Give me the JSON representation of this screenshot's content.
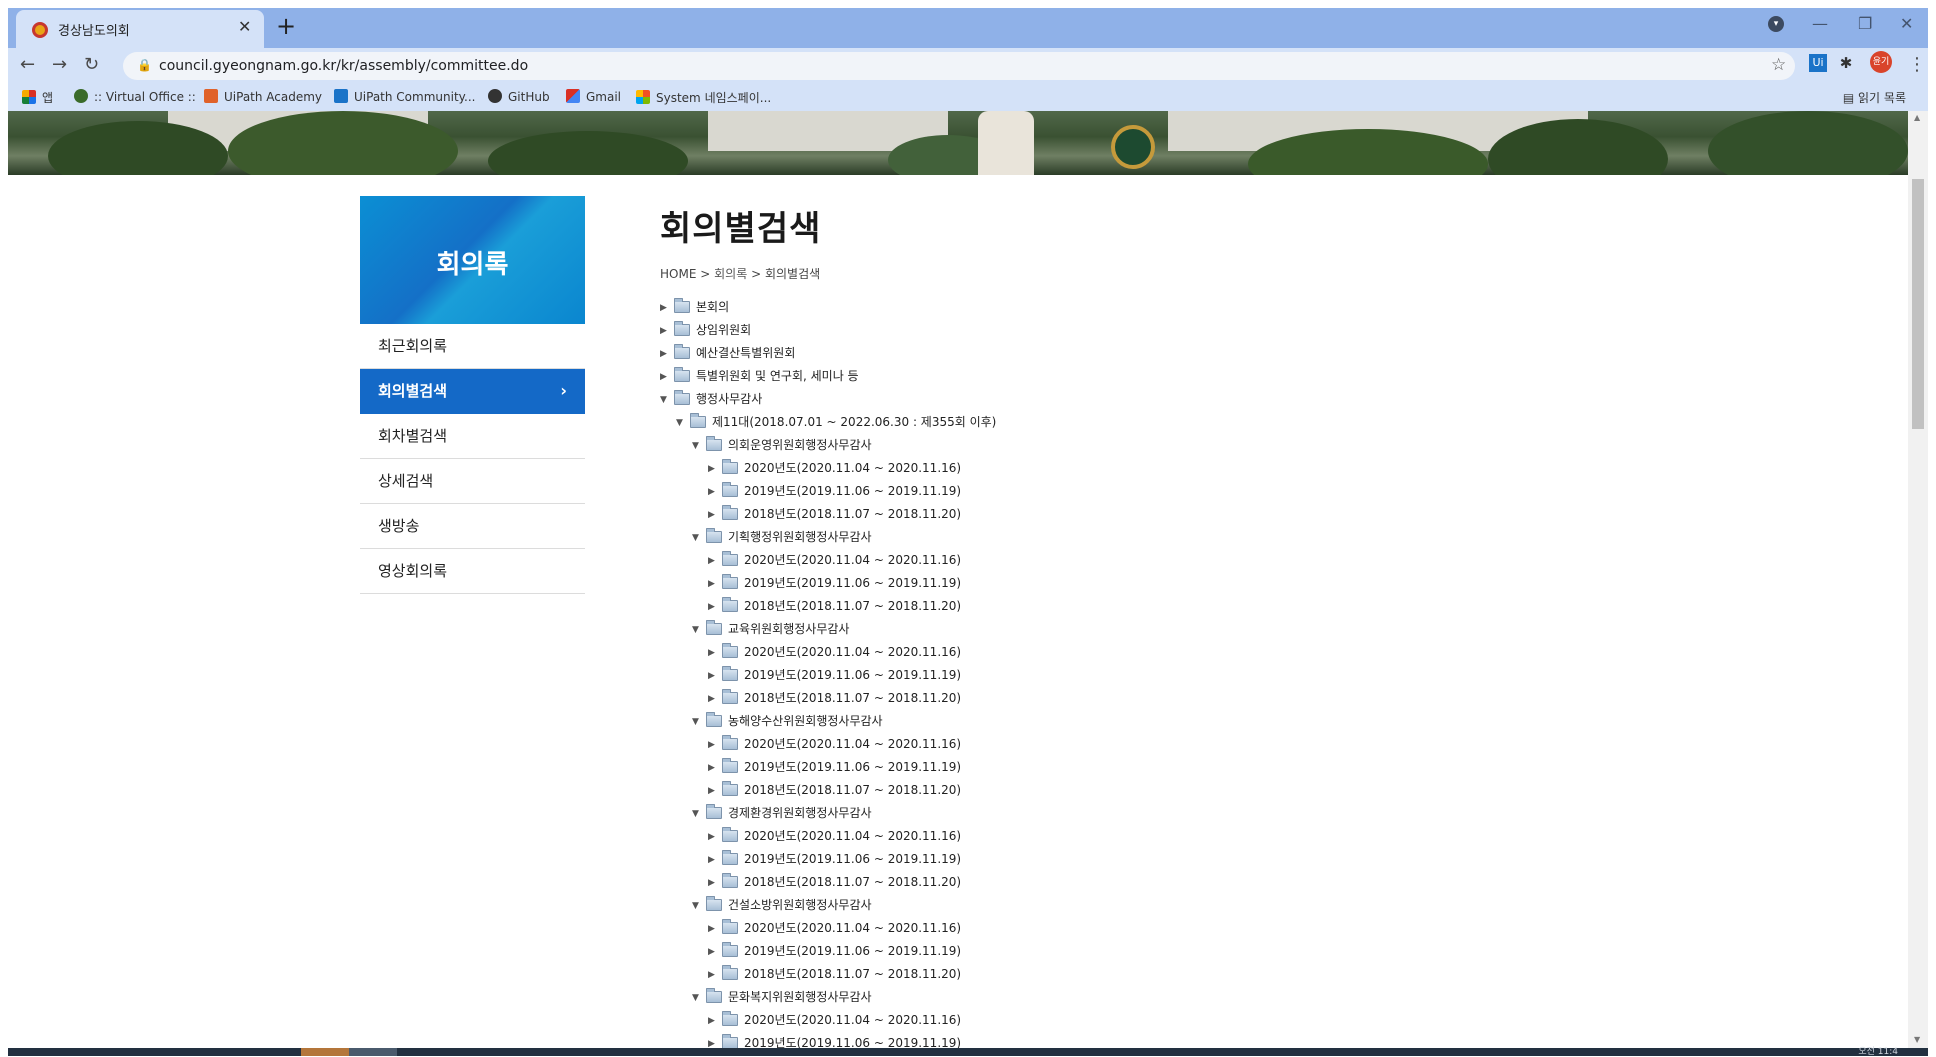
{
  "browser": {
    "tab_title": "경상남도의회",
    "tab_close": "✕",
    "new_tab": "+",
    "url": "council.gyeongnam.go.kr/kr/assembly/committee.do",
    "user_label": "윤기",
    "bookmarks": [
      {
        "label": "앱",
        "icon": "apps-grid-icon",
        "color": "#d93025"
      },
      {
        "label": ":: Virtual Office ::",
        "icon": "virtual-office-icon",
        "color": "#3a6b2a"
      },
      {
        "label": "UiPath Academy",
        "icon": "uipath-icon",
        "color": "#e0622a"
      },
      {
        "label": "UiPath Community...",
        "icon": "uipath-icon",
        "color": "#1a73c8"
      },
      {
        "label": "GitHub",
        "icon": "github-icon",
        "color": "#333333"
      },
      {
        "label": "Gmail",
        "icon": "gmail-icon",
        "color": "#d93025"
      },
      {
        "label": "System 네임스페이...",
        "icon": "windows-icon",
        "color": "#2b7bd9"
      }
    ],
    "reading_list": "읽기 목록"
  },
  "sidebar": {
    "title": "회의록",
    "items": [
      {
        "label": "최근회의록",
        "active": false
      },
      {
        "label": "회의별검색",
        "active": true,
        "chevron": "›"
      },
      {
        "label": "회차별검색",
        "active": false
      },
      {
        "label": "상세검색",
        "active": false
      },
      {
        "label": "생방송",
        "active": false
      },
      {
        "label": "영상회의록",
        "active": false
      }
    ]
  },
  "main": {
    "title": "회의별검색",
    "breadcrumb": {
      "home": "HOME",
      "sep": ">",
      "level1": "회의록",
      "level2": "회의별검색"
    }
  },
  "tree": [
    {
      "label": "본회의",
      "level": 0,
      "expanded": false
    },
    {
      "label": "상임위원회",
      "level": 0,
      "expanded": false
    },
    {
      "label": "예산결산특별위원회",
      "level": 0,
      "expanded": false
    },
    {
      "label": "특별위원회 및 연구회, 세미나 등",
      "level": 0,
      "expanded": false
    },
    {
      "label": "행정사무감사",
      "level": 0,
      "expanded": true
    },
    {
      "label": "제11대(2018.07.01 ~ 2022.06.30 : 제355회 이후)",
      "level": 1,
      "expanded": true
    },
    {
      "label": "의회운영위원회행정사무감사",
      "level": 2,
      "expanded": true
    },
    {
      "label": "2020년도(2020.11.04 ~ 2020.11.16)",
      "level": 3,
      "expanded": false
    },
    {
      "label": "2019년도(2019.11.06 ~ 2019.11.19)",
      "level": 3,
      "expanded": false
    },
    {
      "label": "2018년도(2018.11.07 ~ 2018.11.20)",
      "level": 3,
      "expanded": false
    },
    {
      "label": "기획행정위원회행정사무감사",
      "level": 2,
      "expanded": true
    },
    {
      "label": "2020년도(2020.11.04 ~ 2020.11.16)",
      "level": 3,
      "expanded": false
    },
    {
      "label": "2019년도(2019.11.06 ~ 2019.11.19)",
      "level": 3,
      "expanded": false
    },
    {
      "label": "2018년도(2018.11.07 ~ 2018.11.20)",
      "level": 3,
      "expanded": false
    },
    {
      "label": "교육위원회행정사무감사",
      "level": 2,
      "expanded": true
    },
    {
      "label": "2020년도(2020.11.04 ~ 2020.11.16)",
      "level": 3,
      "expanded": false
    },
    {
      "label": "2019년도(2019.11.06 ~ 2019.11.19)",
      "level": 3,
      "expanded": false
    },
    {
      "label": "2018년도(2018.11.07 ~ 2018.11.20)",
      "level": 3,
      "expanded": false
    },
    {
      "label": "농해양수산위원회행정사무감사",
      "level": 2,
      "expanded": true
    },
    {
      "label": "2020년도(2020.11.04 ~ 2020.11.16)",
      "level": 3,
      "expanded": false
    },
    {
      "label": "2019년도(2019.11.06 ~ 2019.11.19)",
      "level": 3,
      "expanded": false
    },
    {
      "label": "2018년도(2018.11.07 ~ 2018.11.20)",
      "level": 3,
      "expanded": false
    },
    {
      "label": "경제환경위원회행정사무감사",
      "level": 2,
      "expanded": true
    },
    {
      "label": "2020년도(2020.11.04 ~ 2020.11.16)",
      "level": 3,
      "expanded": false
    },
    {
      "label": "2019년도(2019.11.06 ~ 2019.11.19)",
      "level": 3,
      "expanded": false
    },
    {
      "label": "2018년도(2018.11.07 ~ 2018.11.20)",
      "level": 3,
      "expanded": false
    },
    {
      "label": "건설소방위원회행정사무감사",
      "level": 2,
      "expanded": true
    },
    {
      "label": "2020년도(2020.11.04 ~ 2020.11.16)",
      "level": 3,
      "expanded": false
    },
    {
      "label": "2019년도(2019.11.06 ~ 2019.11.19)",
      "level": 3,
      "expanded": false
    },
    {
      "label": "2018년도(2018.11.07 ~ 2018.11.20)",
      "level": 3,
      "expanded": false
    },
    {
      "label": "문화복지위원회행정사무감사",
      "level": 2,
      "expanded": true
    },
    {
      "label": "2020년도(2020.11.04 ~ 2020.11.16)",
      "level": 3,
      "expanded": false
    },
    {
      "label": "2019년도(2019.11.06 ~ 2019.11.19)",
      "level": 3,
      "expanded": false
    }
  ],
  "taskbar": {
    "clock": "오전 11:4"
  }
}
